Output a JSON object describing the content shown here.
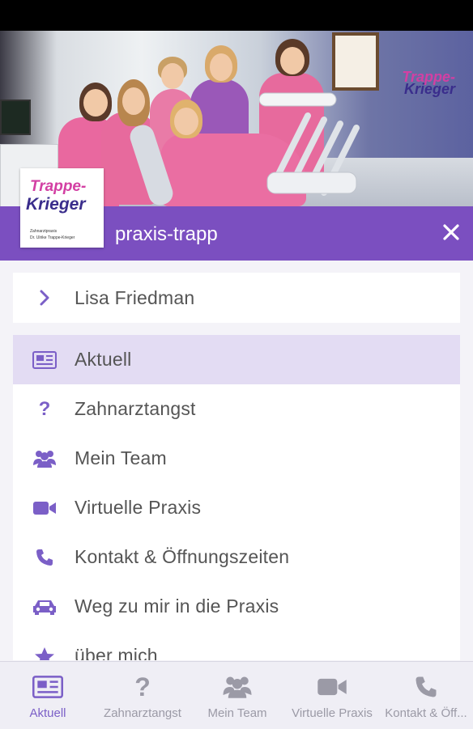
{
  "header": {
    "title": "praxis-trapp",
    "close_icon": "close-icon"
  },
  "logo": {
    "line1": "Trappe-",
    "line2": "Krieger",
    "sub1": "Zahnarztpraxis",
    "sub2": "Dr. Ulrike Trappe-Krieger"
  },
  "hero_brand": {
    "line1": "Trappe-",
    "line2": "Krieger"
  },
  "user": {
    "name": "Lisa Friedman",
    "icon": "chevron-right-icon"
  },
  "menu": {
    "items": [
      {
        "label": "Aktuell",
        "icon": "newspaper-icon",
        "active": true
      },
      {
        "label": "Zahnarztangst",
        "icon": "question-icon"
      },
      {
        "label": "Mein Team",
        "icon": "users-icon"
      },
      {
        "label": "Virtuelle Praxis",
        "icon": "video-camera-icon"
      },
      {
        "label": "Kontakt & Öffnungszeiten",
        "icon": "phone-icon"
      },
      {
        "label": "Weg zu mir in die Praxis",
        "icon": "car-icon"
      },
      {
        "label": "über mich",
        "icon": "star-icon"
      }
    ]
  },
  "bottom_nav": {
    "tabs": [
      {
        "label": "Aktuell",
        "icon": "newspaper-icon",
        "active": true
      },
      {
        "label": "Zahnarztangst",
        "icon": "question-icon"
      },
      {
        "label": "Mein Team",
        "icon": "users-icon"
      },
      {
        "label": "Virtuelle Praxis",
        "icon": "video-camera-icon"
      },
      {
        "label": "Kontakt & Öff...",
        "icon": "phone-icon"
      }
    ]
  },
  "colors": {
    "accent": "#7b4fc0",
    "icon": "#7b5fc7",
    "active_row": "#e3dcf3"
  }
}
